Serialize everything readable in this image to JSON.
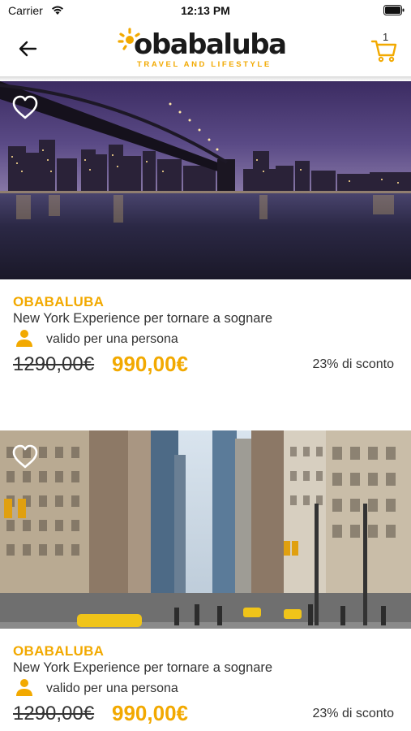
{
  "status_bar": {
    "carrier": "Carrier",
    "time": "12:13 PM"
  },
  "nav": {
    "back_icon": "arrow-left-icon",
    "logo_text": "obabaluba",
    "logo_tagline": "TRAVEL AND LIFESTYLE",
    "cart_icon": "cart-icon",
    "cart_count": "1"
  },
  "colors": {
    "accent": "#f2a900",
    "text": "#333333"
  },
  "products": [
    {
      "image": "brooklyn-bridge-night",
      "favorite_icon": "heart-outline-icon",
      "brand": "OBABALUBA",
      "title": "New York Experience per tornare a sognare",
      "validity_icon": "person-icon",
      "validity": "valido per una persona",
      "old_price": "1290,00€",
      "new_price": "990,00€",
      "discount": "23% di sconto"
    },
    {
      "image": "new-york-street",
      "favorite_icon": "heart-outline-icon",
      "brand": "OBABALUBA",
      "title": "New York Experience per tornare a sognare",
      "validity_icon": "person-icon",
      "validity": "valido per una persona",
      "old_price": "1290,00€",
      "new_price": "990,00€",
      "discount": "23% di sconto"
    }
  ]
}
